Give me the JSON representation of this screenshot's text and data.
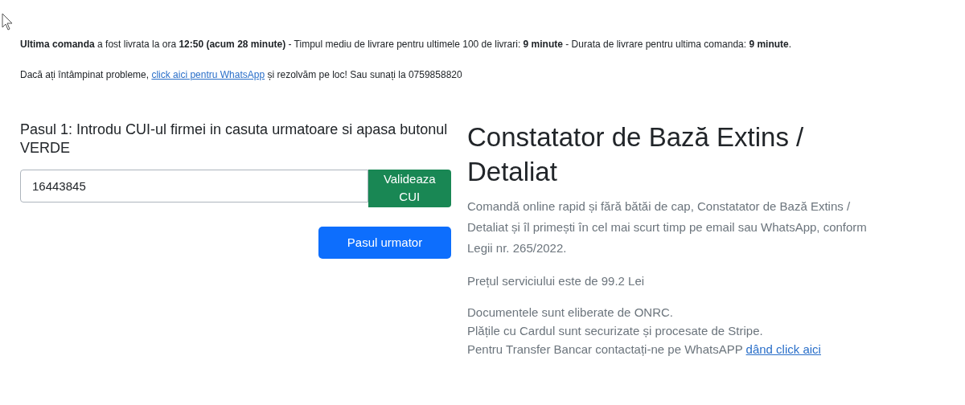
{
  "notice": "**Ultima comanda** a fost livrata la ora **12:50 (acum 28 minute)** - Timpul mediu de livrare pentru ultimele 100 de livrari: **9 minute** - Durata de livrare pentru ultima comanda: **9 minute**.",
  "help": {
    "before": "Dacă ați întâmpinat probleme, ",
    "link": "click aici pentru WhatsApp",
    "after": " și rezolvăm pe loc! Sau sunați la 0759858820"
  },
  "step": {
    "heading": "Pasul 1: Introdu CUI-ul firmei in casuta urmatoare si apasa butonul VERDE",
    "cui_value": "16443845",
    "validate_button": "Valideaza CUI",
    "next_button": "Pasul urmator"
  },
  "product": {
    "title": "Constatator de Bază Extins / Detaliat",
    "description": "Comandă online rapid și fără bătăi de cap, Constatator de Bază Extins / Detaliat și îl primești în cel mai scurt timp pe email sau WhatsApp, conform Legii nr. 265/2022.",
    "price": "Prețul serviciului este de 99.2 Lei",
    "notes": [
      {
        "text": "Documentele sunt eliberate de ONRC."
      },
      {
        "text": "Plățile cu Cardul sunt securizate și procesate de Stripe."
      },
      {
        "text": "Pentru Transfer Bancar contactați-ne pe WhatsAPP ",
        "link": "dând click aici"
      }
    ]
  }
}
